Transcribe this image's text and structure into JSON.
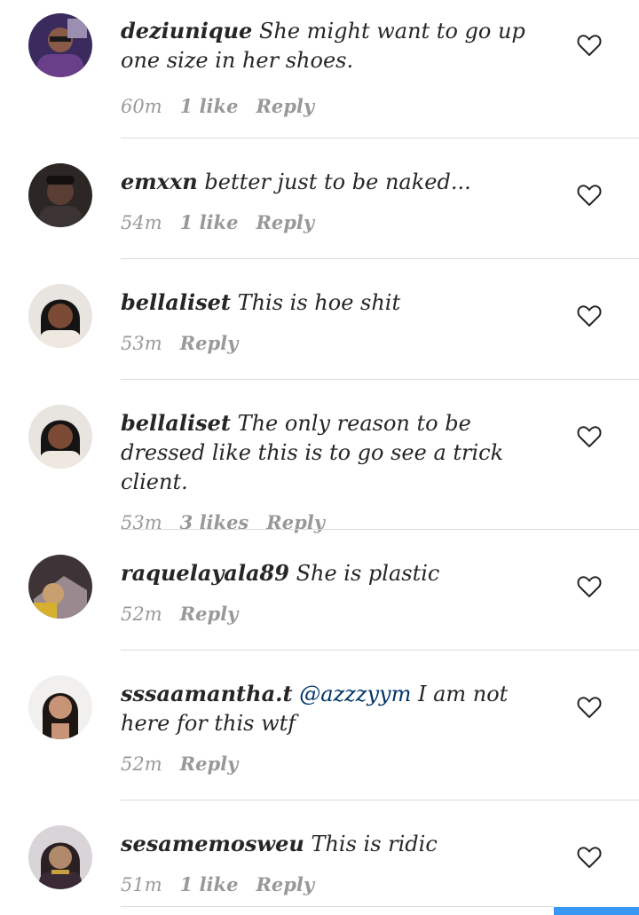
{
  "comments": [
    {
      "username": "deziunique",
      "mention": "",
      "text": "She might want to go up one size in her shoes.",
      "time": "60m",
      "likes": "1 like",
      "reply": "Reply"
    },
    {
      "username": "emxxn",
      "mention": "",
      "text": "better just to be naked...",
      "time": "54m",
      "likes": "1 like",
      "reply": "Reply"
    },
    {
      "username": "bellaliset",
      "mention": "",
      "text": "This is hoe shit",
      "time": "53m",
      "likes": "",
      "reply": "Reply"
    },
    {
      "username": "bellaliset",
      "mention": "",
      "text": "The only reason to be dressed like this is to go see a trick client.",
      "time": "53m",
      "likes": "3 likes",
      "reply": "Reply"
    },
    {
      "username": "raquelayala89",
      "mention": "",
      "text": "She is plastic",
      "time": "52m",
      "likes": "",
      "reply": "Reply"
    },
    {
      "username": "sssaamantha.t",
      "mention": "@azzzyym",
      "text": "I am not here for this wtf",
      "time": "52m",
      "likes": "",
      "reply": "Reply"
    },
    {
      "username": "sesamemosweu",
      "mention": "",
      "text": "This is ridic",
      "time": "51m",
      "likes": "1 like",
      "reply": "Reply"
    }
  ],
  "icons": {
    "like": "heart-outline-icon"
  },
  "colors": {
    "text": "#262626",
    "meta": "#999999",
    "mention": "#003569",
    "accent": "#3897f0",
    "divider": "#dbdbdb"
  }
}
